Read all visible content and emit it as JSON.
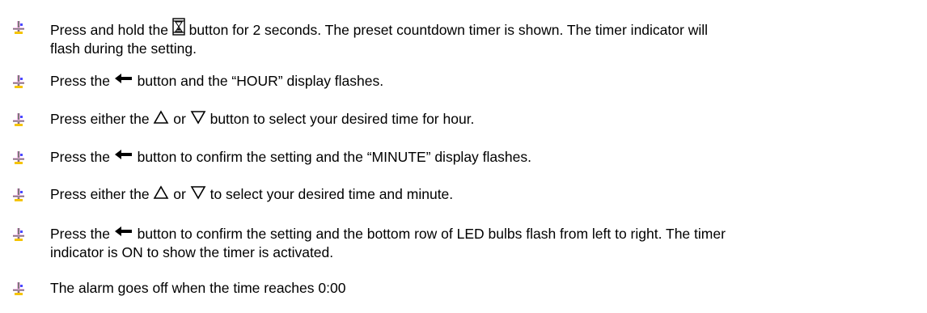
{
  "colors": {
    "bullet_dark": "#7a7a7a",
    "bullet_light": "#f4b7e8",
    "bullet_accent": "#4a4aff",
    "bullet_yellow": "#f5c400"
  },
  "icons": [
    "hourglass-icon",
    "left-arrow-icon",
    "up-triangle-icon",
    "down-triangle-icon",
    "bullet-icon"
  ],
  "steps": [
    {
      "a": "Press and hold the ",
      "b": " button for 2 seconds. The preset countdown timer is shown.  The timer indicator will",
      "c": "flash during the setting."
    },
    {
      "a": " Press the ",
      "b": " button and the “HOUR” display flashes."
    },
    {
      "a": "Press either the ",
      "b": " or ",
      "c": " button to select your desired time for hour."
    },
    {
      "a": "Press the ",
      "b": " button to confirm the setting and the “MINUTE” display flashes."
    },
    {
      "a": "Press either the ",
      "b": " or ",
      "c": " to select your desired time and minute."
    },
    {
      "a": "Press the ",
      "b": " button to confirm the setting and the bottom row of LED bulbs flash from left to right.  The timer",
      "c": "indicator is ON to show the timer is activated."
    },
    {
      "a": "The alarm goes off when the time reaches 0:00"
    }
  ]
}
